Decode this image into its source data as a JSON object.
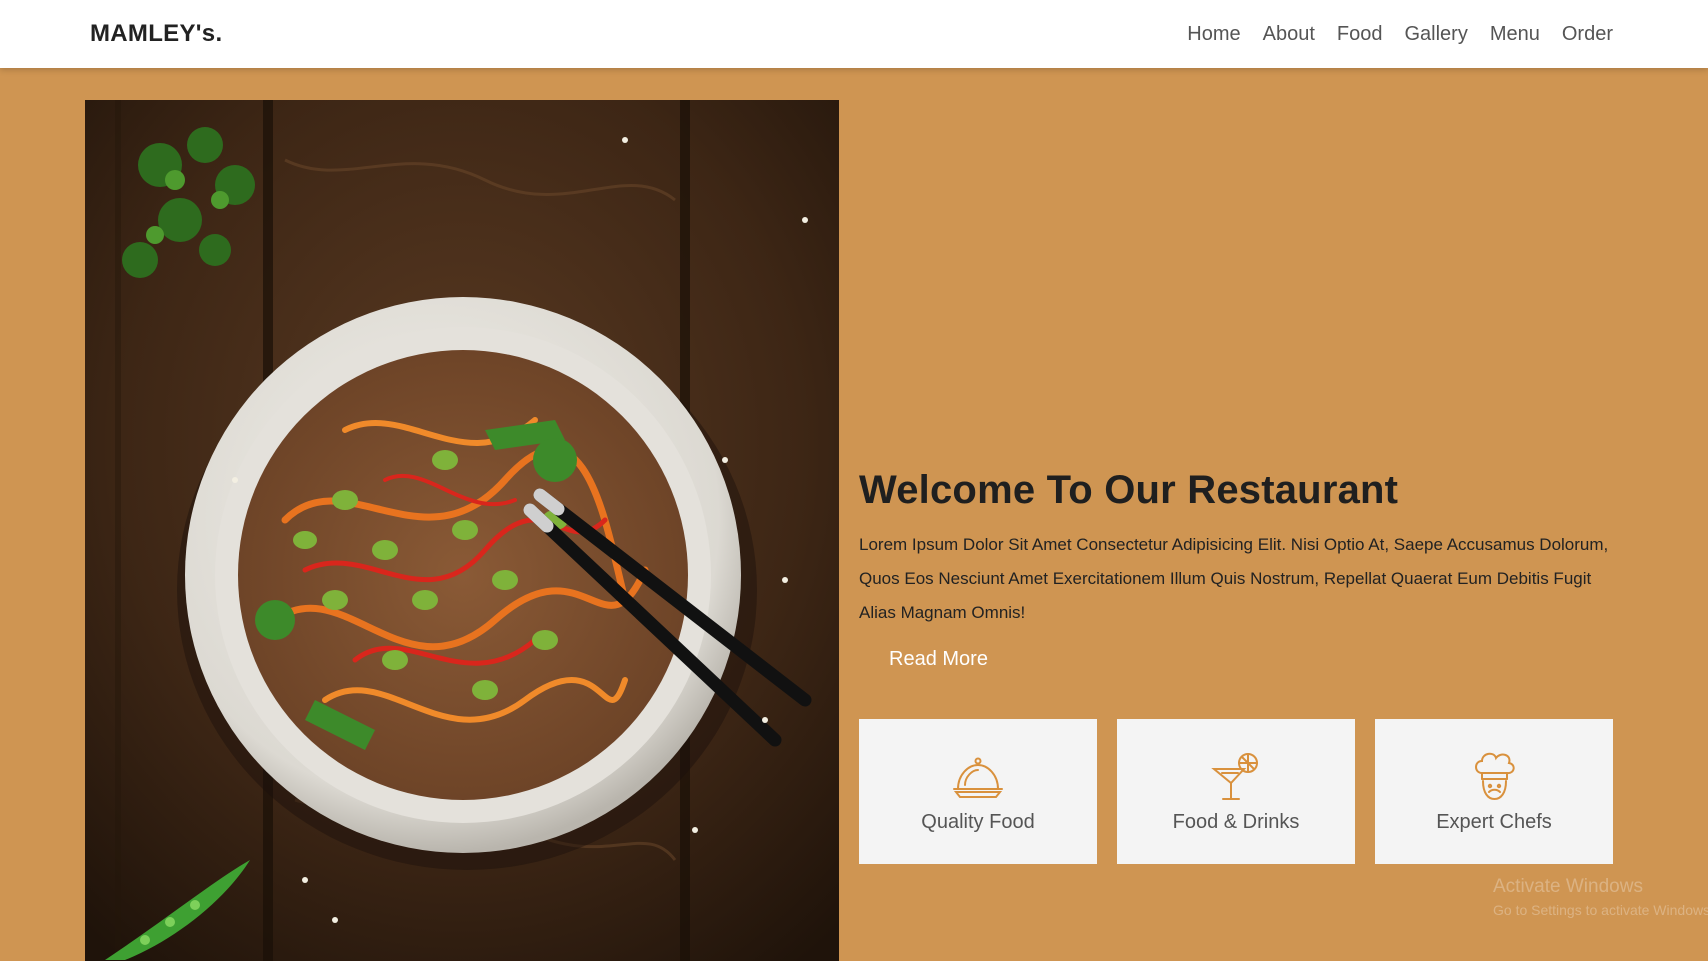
{
  "brand": "MAMLEY's.",
  "nav": {
    "items": [
      "Home",
      "About",
      "Food",
      "Gallery",
      "Menu",
      "Order"
    ]
  },
  "hero": {
    "image_subject": "bowl of soba noodles with vegetables and chopsticks on wooden table",
    "title": "Welcome To Our Restaurant",
    "text": "Lorem Ipsum Dolor Sit Amet Consectetur Adipisicing Elit. Nisi Optio At, Saepe Accusamus Dolorum, Quos Eos Nesciunt Amet Exercitationem Illum Quis Nostrum, Repellat Quaerat Eum Debitis Fugit Alias Magnam Omnis!",
    "read_more": "Read More"
  },
  "features": [
    {
      "icon": "cloche-icon",
      "label": "Quality Food"
    },
    {
      "icon": "cocktail-icon",
      "label": "Food & Drinks"
    },
    {
      "icon": "chef-icon",
      "label": "Expert Chefs"
    }
  ],
  "watermark": {
    "line1": "Activate Windows",
    "line2": "Go to Settings to activate Windows."
  },
  "colors": {
    "background": "#cf9552",
    "accent": "#d9913d",
    "card": "#f4f4f4"
  }
}
